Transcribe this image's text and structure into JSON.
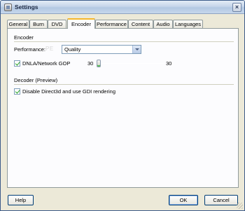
{
  "window": {
    "title": "Settings",
    "close_glyph": "×"
  },
  "tabs": [
    {
      "label": "General",
      "active": false
    },
    {
      "label": "Burn",
      "active": false
    },
    {
      "label": "DVD",
      "active": false
    },
    {
      "label": "Encoder",
      "active": true
    },
    {
      "label": "Performance",
      "active": false
    },
    {
      "label": "Content",
      "active": false
    },
    {
      "label": "Audio",
      "active": false
    },
    {
      "label": "Languages",
      "active": false
    }
  ],
  "encoder": {
    "group_label": "Encoder",
    "performance_label": "Performance:",
    "performance_watermark": "PE",
    "performance_value": "Quality",
    "dnla_label": "DNLA/Network GOP",
    "dnla_checked": true,
    "gop_min_value": "30",
    "gop_max_value": "30"
  },
  "decoder": {
    "group_label": "Decoder (Preview)",
    "gdi_label": "Disable Direct3d and use GDI rendering",
    "gdi_checked": true
  },
  "buttons": {
    "help": "Help",
    "ok": "OK",
    "cancel": "Cancel"
  },
  "colors": {
    "accent_tab": "#f5b72c",
    "check": "#21a121",
    "slider_thumb_accent": "#5bbd5b"
  }
}
